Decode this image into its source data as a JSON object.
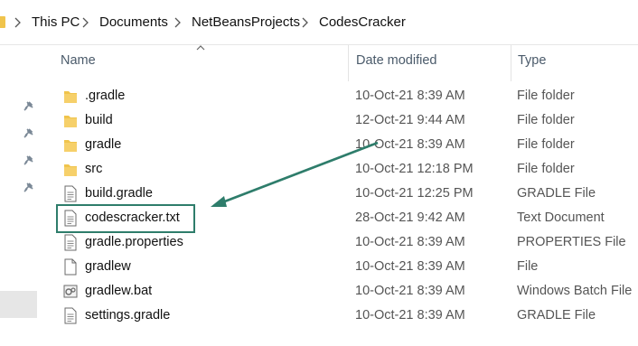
{
  "breadcrumb": {
    "items": [
      "This PC",
      "Documents",
      "NetBeansProjects",
      "CodesCracker"
    ]
  },
  "columns": {
    "name": "Name",
    "date_modified": "Date modified",
    "type": "Type"
  },
  "files": [
    {
      "name": ".gradle",
      "date": "10-Oct-21 8:39 AM",
      "type": "File folder",
      "icon": "folder-icon"
    },
    {
      "name": "build",
      "date": "12-Oct-21 9:44 AM",
      "type": "File folder",
      "icon": "folder-icon"
    },
    {
      "name": "gradle",
      "date": "10-Oct-21 8:39 AM",
      "type": "File folder",
      "icon": "folder-icon"
    },
    {
      "name": "src",
      "date": "10-Oct-21 12:18 PM",
      "type": "File folder",
      "icon": "folder-icon"
    },
    {
      "name": "build.gradle",
      "date": "10-Oct-21 12:25 PM",
      "type": "GRADLE File",
      "icon": "text-file-icon"
    },
    {
      "name": "codescracker.txt",
      "date": "28-Oct-21 9:42 AM",
      "type": "Text Document",
      "icon": "text-file-icon"
    },
    {
      "name": "gradle.properties",
      "date": "10-Oct-21 8:39 AM",
      "type": "PROPERTIES File",
      "icon": "text-file-icon"
    },
    {
      "name": "gradlew",
      "date": "10-Oct-21 8:39 AM",
      "type": "File",
      "icon": "blank-file-icon"
    },
    {
      "name": "gradlew.bat",
      "date": "10-Oct-21 8:39 AM",
      "type": "Windows Batch File",
      "icon": "batch-file-icon"
    },
    {
      "name": "settings.gradle",
      "date": "10-Oct-21 8:39 AM",
      "type": "GRADLE File",
      "icon": "text-file-icon"
    }
  ],
  "colors": {
    "folder": "#f0c44c",
    "highlight": "#2e7d6b"
  }
}
